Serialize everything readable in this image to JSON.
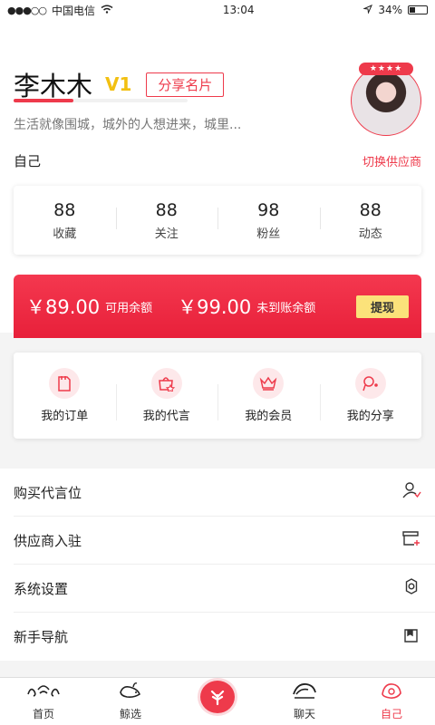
{
  "status": {
    "carrier": "中国电信",
    "time": "13:04",
    "battery": "34%",
    "battery_level": 0.34
  },
  "profile": {
    "name": "李木木",
    "level": "V1",
    "share_label": "分享名片",
    "bio": "生活就像围城，城外的人想进来，城里...",
    "self_label": "自己",
    "switch_label": "切换供应商",
    "avatar_badge": "★★★★"
  },
  "stats": [
    {
      "value": "88",
      "label": "收藏"
    },
    {
      "value": "88",
      "label": "关注"
    },
    {
      "value": "98",
      "label": "粉丝"
    },
    {
      "value": "88",
      "label": "动态"
    }
  ],
  "balance": {
    "available_amount": "￥89.00",
    "available_label": "可用余额",
    "pending_amount": "￥99.00",
    "pending_label": "未到账余额",
    "withdraw_label": "提现"
  },
  "quick_actions": [
    {
      "label": "我的订单",
      "icon": "order-icon"
    },
    {
      "label": "我的代言",
      "icon": "endorse-icon"
    },
    {
      "label": "我的会员",
      "icon": "crown-icon"
    },
    {
      "label": "我的分享",
      "icon": "share-icon"
    }
  ],
  "menu": [
    {
      "label": "购买代言位",
      "icon": "user-add-icon"
    },
    {
      "label": "供应商入驻",
      "icon": "store-icon"
    },
    {
      "label": "系统设置",
      "icon": "gear-icon"
    },
    {
      "label": "新手导航",
      "icon": "book-icon"
    }
  ],
  "tabs": [
    {
      "label": "首页",
      "icon": "home-icon"
    },
    {
      "label": "鲸选",
      "icon": "whale-icon"
    },
    {
      "label": "",
      "icon": "center-logo-icon"
    },
    {
      "label": "聊天",
      "icon": "chat-icon"
    },
    {
      "label": "自己",
      "icon": "self-icon",
      "active": true
    }
  ],
  "colors": {
    "accent": "#ee3a4b",
    "vip": "#f2c012",
    "withdraw_bg": "#fbe27a"
  }
}
